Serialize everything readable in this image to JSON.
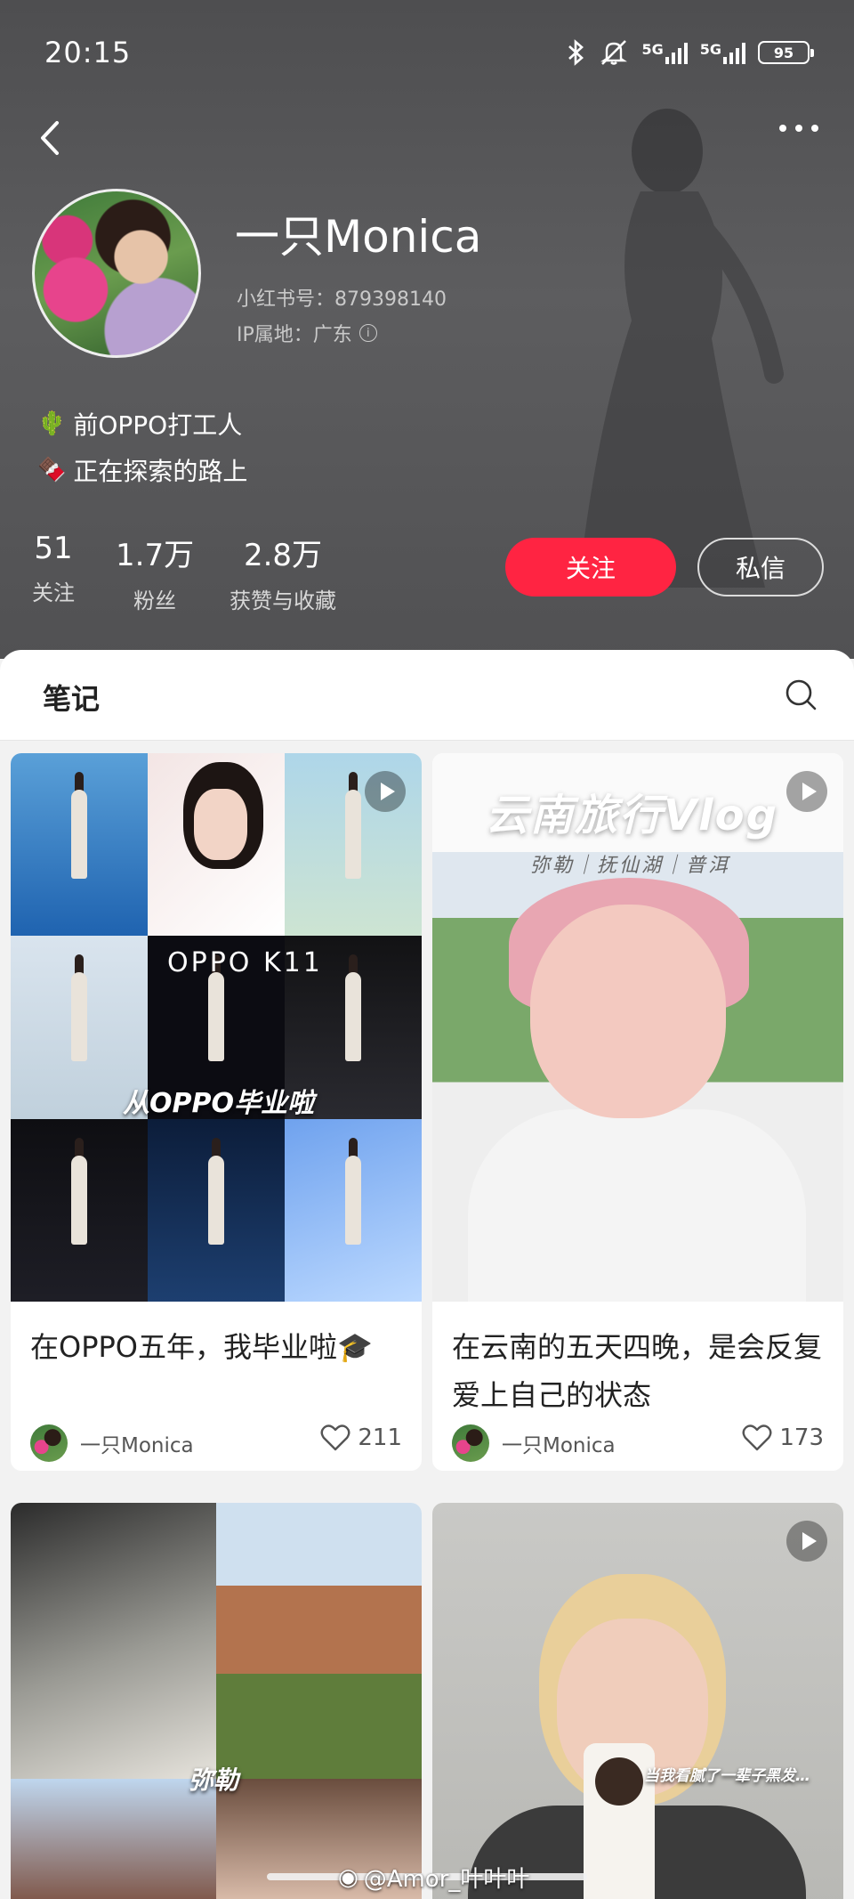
{
  "status_bar": {
    "time": "20:15",
    "network1": "5G",
    "network2": "5G",
    "battery": "95"
  },
  "profile": {
    "name": "一只Monica",
    "id_line": "小红书号：879398140",
    "ip_line": "IP属地：广东",
    "bio": [
      {
        "icon": "cactus-icon",
        "emoji": "🌵",
        "text": "前OPPO打工人"
      },
      {
        "icon": "chocolate-icon",
        "emoji": "🍫",
        "text": "正在探索的路上"
      }
    ],
    "stats": [
      {
        "value": "51",
        "label": "关注"
      },
      {
        "value": "1.7万",
        "label": "粉丝"
      },
      {
        "value": "2.8万",
        "label": "获赞与收藏"
      }
    ],
    "follow_label": "关注",
    "message_label": "私信"
  },
  "notes_bar": {
    "title": "笔记"
  },
  "cards": [
    {
      "overlay_text": "从OPPO毕业啦",
      "logo_text": "OPPO K11",
      "title": "在OPPO五年，我毕业啦🎓",
      "author": "一只Monica",
      "likes": "211",
      "has_video": true
    },
    {
      "overlay_title": "云南旅行Vlog",
      "overlay_sub": "弥勒｜抚仙湖｜普洱",
      "title": "在云南的五天四晚，是会反复爱上自己的状态",
      "author": "一只Monica",
      "likes": "173",
      "has_video": true
    },
    {
      "overlay_text": "弥勒",
      "has_video": false
    },
    {
      "overlay_text": "当我看腻了一辈子黑发…",
      "has_video": true
    }
  ],
  "watermark": "@Amor_叶叶叶",
  "colors": {
    "accent": "#ff2442",
    "header_bg": "#565658"
  }
}
